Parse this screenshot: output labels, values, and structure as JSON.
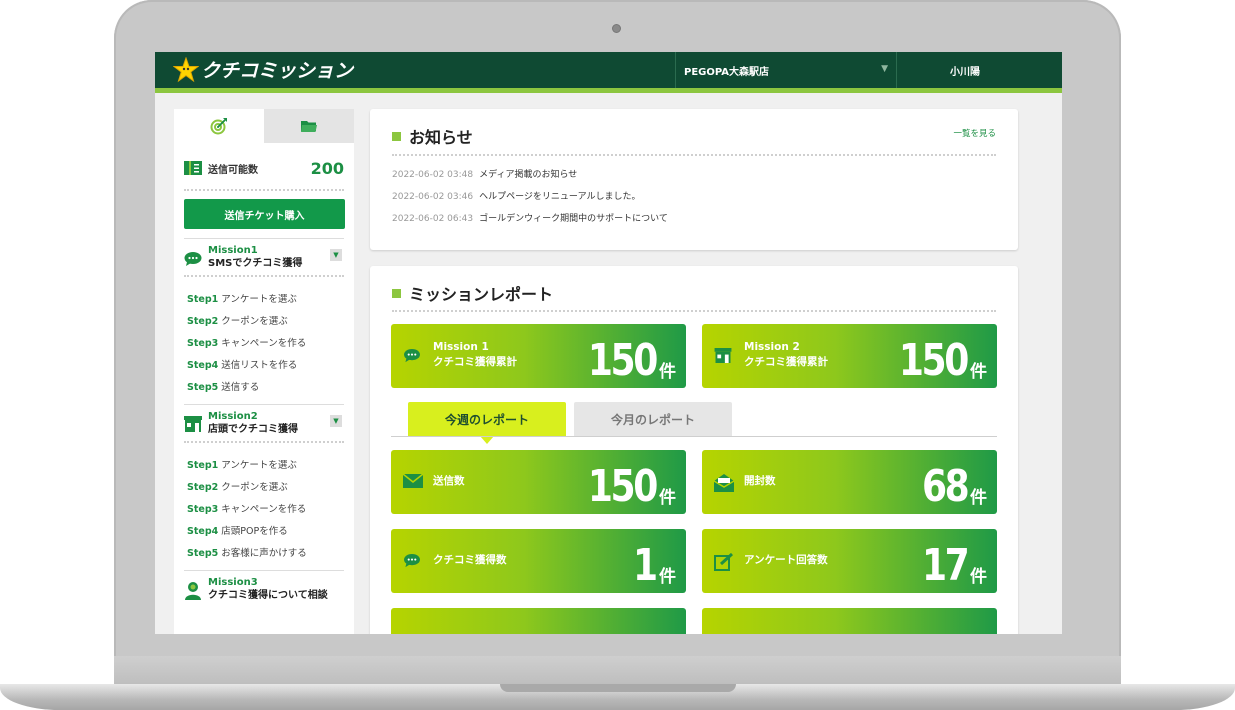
{
  "header": {
    "logo_text": "クチコミッション",
    "store_name": "PEGOPA大森駅店",
    "user_name": "小川陽"
  },
  "sidebar": {
    "tabs": [
      {
        "icon": "target-icon"
      },
      {
        "icon": "folder-icon"
      }
    ],
    "ticket_label": "送信可能数",
    "ticket_count": "200",
    "buy_button": "送信チケット購入",
    "missions": [
      {
        "title": "Mission1",
        "subtitle": "SMSでクチコミ獲得",
        "icon": "chat-bubble-icon",
        "steps": [
          {
            "num": "Step1",
            "text": "アンケートを選ぶ"
          },
          {
            "num": "Step2",
            "text": "クーポンを選ぶ"
          },
          {
            "num": "Step3",
            "text": "キャンペーンを作る"
          },
          {
            "num": "Step4",
            "text": "送信リストを作る"
          },
          {
            "num": "Step5",
            "text": "送信する"
          }
        ]
      },
      {
        "title": "Mission2",
        "subtitle": "店頭でクチコミ獲得",
        "icon": "storefront-icon",
        "steps": [
          {
            "num": "Step1",
            "text": "アンケートを選ぶ"
          },
          {
            "num": "Step2",
            "text": "クーポンを選ぶ"
          },
          {
            "num": "Step3",
            "text": "キャンペーンを作る"
          },
          {
            "num": "Step4",
            "text": "店頭POPを作る"
          },
          {
            "num": "Step5",
            "text": "お客様に声かけする"
          }
        ]
      },
      {
        "title": "Mission3",
        "subtitle": "クチコミ獲得について相談",
        "icon": "person-icon"
      }
    ]
  },
  "news": {
    "title": "お知らせ",
    "more_link": "一覧を見る",
    "items": [
      {
        "date": "2022-06-02 03:48",
        "text": "メディア掲載のお知らせ"
      },
      {
        "date": "2022-06-02 03:46",
        "text": "ヘルプページをリニューアルしました。"
      },
      {
        "date": "2022-06-02 06:43",
        "text": "ゴールデンウィーク期間中のサポートについて"
      }
    ]
  },
  "report": {
    "title": "ミッションレポート",
    "totals": [
      {
        "mission": "Mission 1",
        "label": "クチコミ獲得累計",
        "value": "150",
        "unit": "件"
      },
      {
        "mission": "Mission 2",
        "label": "クチコミ獲得累計",
        "value": "150",
        "unit": "件"
      }
    ],
    "tabs": [
      {
        "label": "今週のレポート",
        "active": true
      },
      {
        "label": "今月のレポート",
        "active": false
      }
    ],
    "stats": [
      {
        "label": "送信数",
        "value": "150",
        "unit": "件",
        "icon": "mail-icon"
      },
      {
        "label": "開封数",
        "value": "68",
        "unit": "件",
        "icon": "open-mail-icon"
      },
      {
        "label": "クチコミ獲得数",
        "value": "1",
        "unit": "件",
        "icon": "chat-bubble-icon"
      },
      {
        "label": "アンケート回答数",
        "value": "17",
        "unit": "件",
        "icon": "edit-icon"
      }
    ]
  },
  "colors": {
    "header_bg": "#0f4a33",
    "accent_green": "#12994a",
    "lime": "#8cc63f",
    "tab_active": "#d8ef1e"
  }
}
